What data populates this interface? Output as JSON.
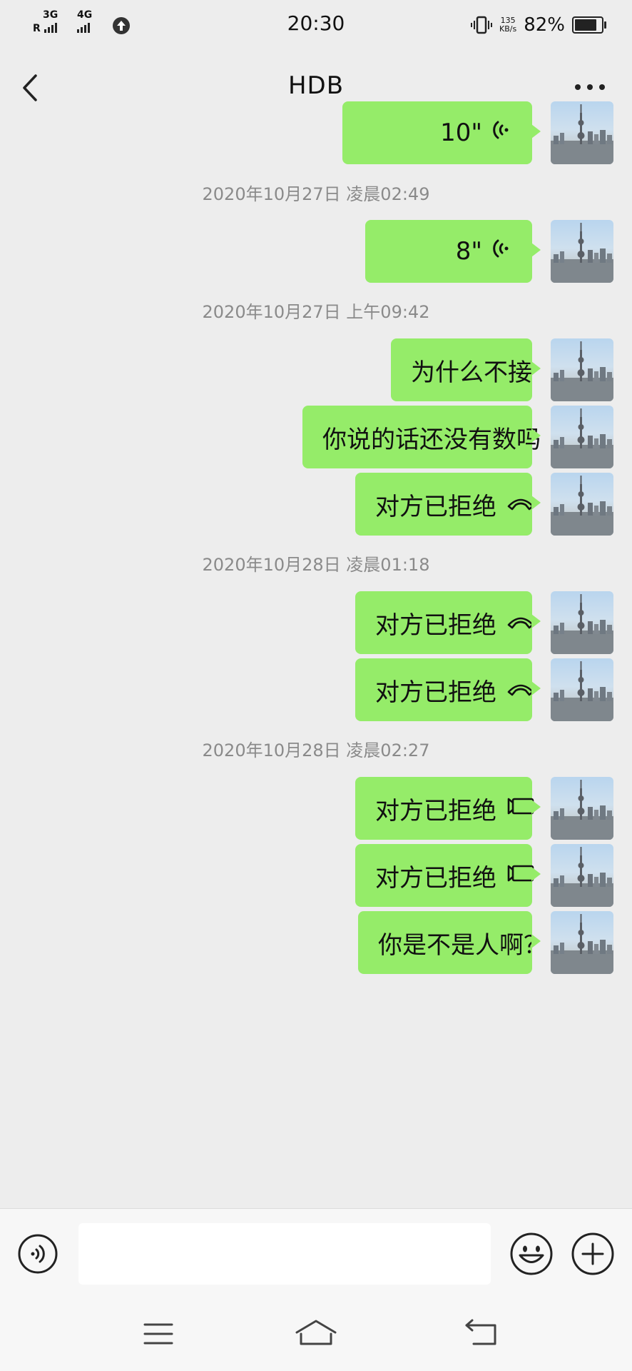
{
  "status_bar": {
    "net1": "3G",
    "net1_prefix": "R",
    "net2": "4G",
    "time": "20:30",
    "speed_value": "135",
    "speed_unit": "KB/s",
    "battery": "82%",
    "battery_level": 0.82
  },
  "header": {
    "title": "HDB",
    "back_icon": "chevron-left-icon",
    "more_icon": "more-dots-icon"
  },
  "messages": [
    {
      "type": "voice",
      "text": "10\"",
      "icon": "voice-wave-icon"
    },
    {
      "type": "timestamp",
      "text": "2020年10月27日 凌晨02:49"
    },
    {
      "type": "voice",
      "text": "8\"",
      "icon": "voice-wave-icon"
    },
    {
      "type": "timestamp",
      "text": "2020年10月27日 上午09:42"
    },
    {
      "type": "text",
      "text": "为什么不接"
    },
    {
      "type": "text",
      "text": "你说的话还没有数吗"
    },
    {
      "type": "call",
      "text": "对方已拒绝",
      "icon": "phone-hangup-icon"
    },
    {
      "type": "timestamp",
      "text": "2020年10月28日 凌晨01:18"
    },
    {
      "type": "call",
      "text": "对方已拒绝",
      "icon": "phone-hangup-icon"
    },
    {
      "type": "call",
      "text": "对方已拒绝",
      "icon": "phone-hangup-icon"
    },
    {
      "type": "timestamp",
      "text": "2020年10月28日 凌晨02:27"
    },
    {
      "type": "call",
      "text": "对方已拒绝",
      "icon": "video-call-icon"
    },
    {
      "type": "call",
      "text": "对方已拒绝",
      "icon": "video-call-icon"
    },
    {
      "type": "text",
      "text": "你是不是人啊？"
    }
  ],
  "input_bar": {
    "value": "",
    "voice_icon": "voice-mode-icon",
    "emoji_icon": "emoji-icon",
    "plus_icon": "plus-icon"
  },
  "colors": {
    "bubble": "#95ec69",
    "background": "#ededed"
  }
}
